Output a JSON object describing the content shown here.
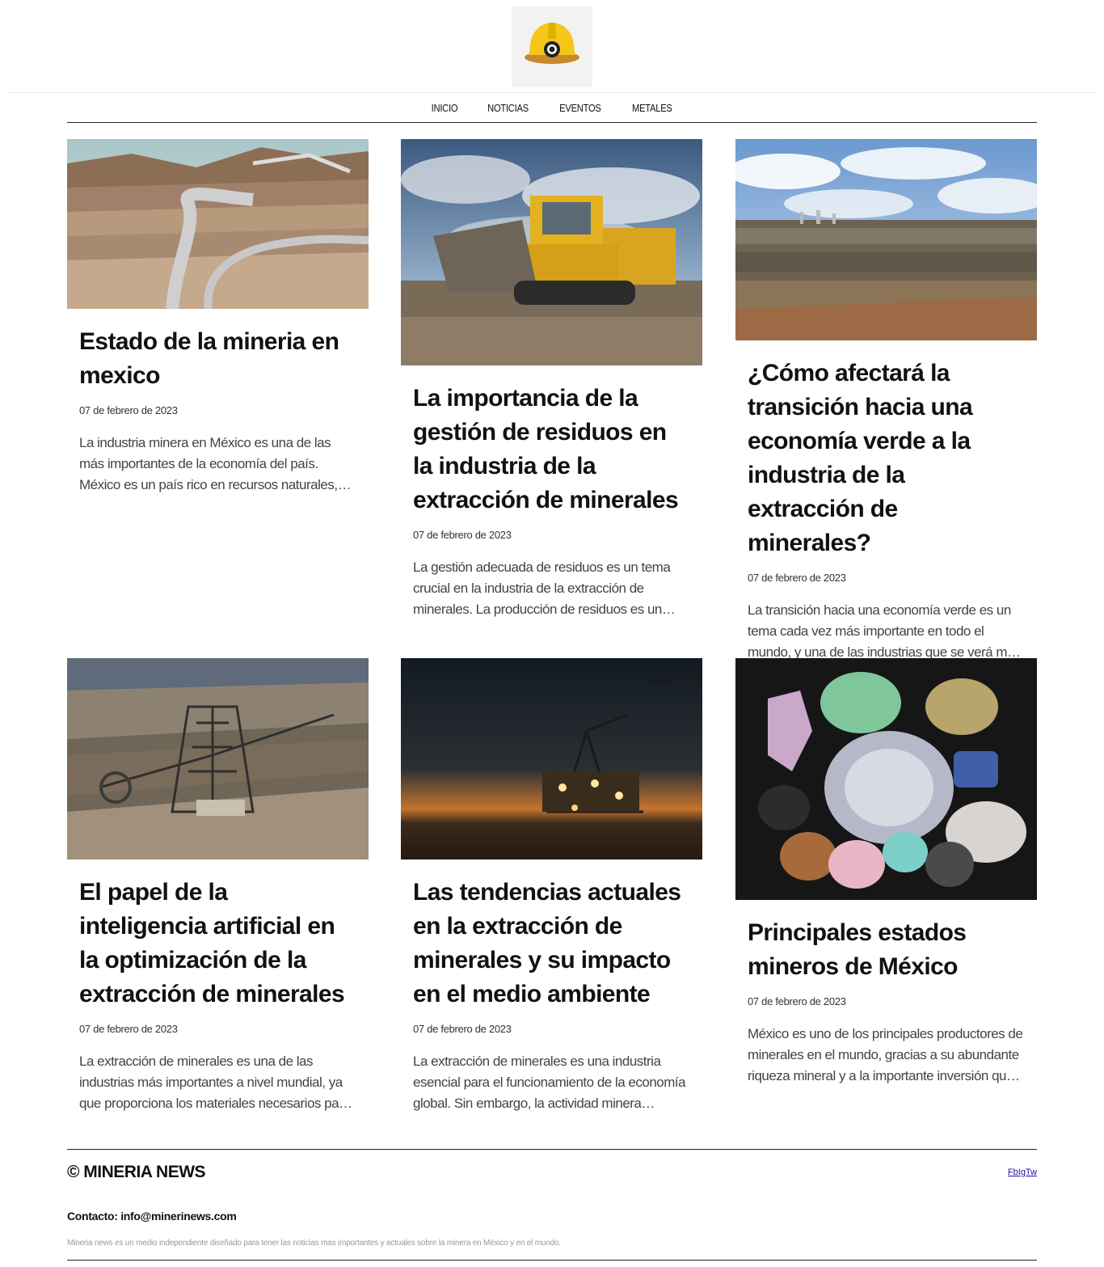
{
  "site": {
    "logo_alt": "hard-hat-logo"
  },
  "nav": {
    "items": [
      "INICIO",
      "NOTICIAS",
      "EVENTOS",
      "METALES"
    ]
  },
  "articles": [
    {
      "title": "Estado de la mineria en mexico",
      "date": "07 de febrero de 2023",
      "excerpt": "La industria minera en México es una de las más importantes de la economía del país. México es un país rico en recursos naturales, especialmente en..."
    },
    {
      "title": "La importancia de la gestión de residuos en la industria de la extracción de minerales",
      "date": "07 de febrero de 2023",
      "excerpt": "La gestión adecuada de residuos es un tema crucial en la industria de la extracción de minerales. La producción de residuos es un subproducto inevitabl..."
    },
    {
      "title": "¿Cómo afectará la transición hacia una economía verde a la industria de la extracción de minerales?",
      "date": "07 de febrero de 2023",
      "excerpt": "La transición hacia una economía verde es un tema cada vez más importante en todo el mundo, y una de las industrias que se verá más afectada por este..."
    },
    {
      "title": "El papel de la inteligencia artificial en la optimización de la extracción de minerales",
      "date": "07 de febrero de 2023",
      "excerpt": "La extracción de minerales es una de las industrias más importantes a nivel mundial, ya que proporciona los materiales necesarios para una gra..."
    },
    {
      "title": "Las tendencias actuales en la extracción de minerales y su impacto en el medio ambiente",
      "date": "07 de febrero de 2023",
      "excerpt": "La extracción de minerales es una industria esencial para el funcionamiento de la economía global. Sin embargo, la actividad minera también tiene un..."
    },
    {
      "title": "Principales estados mineros de México",
      "date": "07 de febrero de 2023",
      "excerpt": "México es uno de los principales productores de minerales en el mundo, gracias a su abundante riqueza mineral y a la importante inversión que se..."
    }
  ],
  "footer": {
    "brand": "© MINERIA NEWS",
    "social": "FbIgTw",
    "contact": "Contacto: info@minerinews.com",
    "about": "Mineria news es un medio independiente diseñado para tener las noticias mas importantes y actuales sobre la minera en México y en el mundo."
  }
}
